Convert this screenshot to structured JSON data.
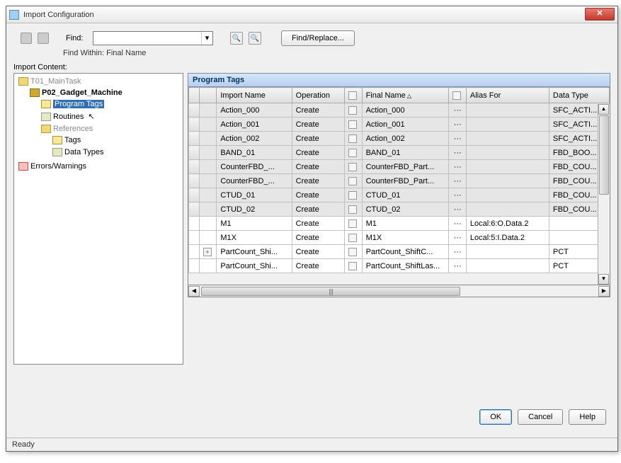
{
  "window": {
    "title": "Import Configuration"
  },
  "toolbar": {
    "find_label": "Find:",
    "find_value": "",
    "find_replace_label": "Find/Replace...",
    "find_within_label": "Find Within: Final Name"
  },
  "tree": {
    "label": "Import Content:",
    "root": "T01_MainTask",
    "program": "P02_Gadget_Machine",
    "program_tags": "Program Tags",
    "routines": "Routines",
    "references": "References",
    "tags": "Tags",
    "data_types": "Data Types",
    "errors": "Errors/Warnings"
  },
  "grid": {
    "title": "Program Tags",
    "headers": {
      "import_name": "Import Name",
      "operation": "Operation",
      "final_name": "Final Name",
      "alias_for": "Alias For",
      "data_type": "Data Type"
    },
    "rows": [
      {
        "white": false,
        "plus": false,
        "name": "Action_000",
        "op": "Create",
        "final": "Action_000",
        "alias": "",
        "dt": "SFC_ACTI..."
      },
      {
        "white": false,
        "plus": false,
        "name": "Action_001",
        "op": "Create",
        "final": "Action_001",
        "alias": "",
        "dt": "SFC_ACTI..."
      },
      {
        "white": false,
        "plus": false,
        "name": "Action_002",
        "op": "Create",
        "final": "Action_002",
        "alias": "",
        "dt": "SFC_ACTI..."
      },
      {
        "white": false,
        "plus": false,
        "name": "BAND_01",
        "op": "Create",
        "final": "BAND_01",
        "alias": "",
        "dt": "FBD_BOO..."
      },
      {
        "white": false,
        "plus": false,
        "name": "CounterFBD_...",
        "op": "Create",
        "final": "CounterFBD_Part...",
        "alias": "",
        "dt": "FBD_COU..."
      },
      {
        "white": false,
        "plus": false,
        "name": "CounterFBD_...",
        "op": "Create",
        "final": "CounterFBD_Part...",
        "alias": "",
        "dt": "FBD_COU..."
      },
      {
        "white": false,
        "plus": false,
        "name": "CTUD_01",
        "op": "Create",
        "final": "CTUD_01",
        "alias": "",
        "dt": "FBD_COU..."
      },
      {
        "white": false,
        "plus": false,
        "name": "CTUD_02",
        "op": "Create",
        "final": "CTUD_02",
        "alias": "",
        "dt": "FBD_COU..."
      },
      {
        "white": true,
        "plus": false,
        "name": "M1",
        "op": "Create",
        "final": "M1",
        "alias": "Local:6:O.Data.2",
        "dt": ""
      },
      {
        "white": true,
        "plus": false,
        "name": "M1X",
        "op": "Create",
        "final": "M1X",
        "alias": "Local:5:I.Data.2",
        "dt": ""
      },
      {
        "white": true,
        "plus": true,
        "name": "PartCount_Shi...",
        "op": "Create",
        "final": "PartCount_ShiftC...",
        "alias": "",
        "dt": "PCT"
      },
      {
        "white": true,
        "plus": false,
        "name": "PartCount_Shi...",
        "op": "Create",
        "final": "PartCount_ShiftLas...",
        "alias": "",
        "dt": "PCT"
      }
    ]
  },
  "buttons": {
    "ok": "OK",
    "cancel": "Cancel",
    "help": "Help"
  },
  "status": "Ready"
}
